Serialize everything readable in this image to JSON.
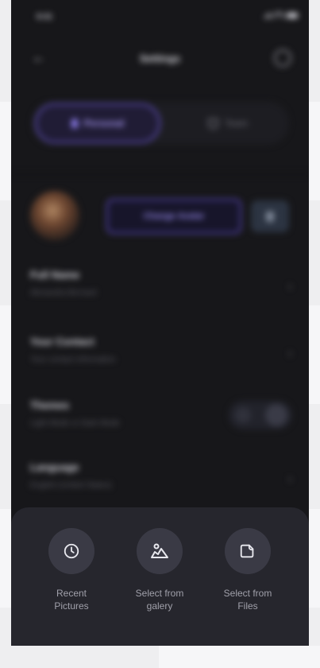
{
  "status_bar": {
    "time": "9:41"
  },
  "header": {
    "title": "Settings"
  },
  "tabs": [
    {
      "label": "Personal",
      "active": true
    },
    {
      "label": "Team",
      "active": false
    }
  ],
  "profile": {
    "change_avatar_label": "Change Avatar"
  },
  "settings_rows": [
    {
      "title": "Full Name",
      "subtitle": "Alexandra Bernard"
    },
    {
      "title": "Your Contact",
      "subtitle": "Your contact information"
    },
    {
      "title": "Themes",
      "subtitle": "Light Mode or Dark Mode"
    },
    {
      "title": "Language",
      "subtitle": "English (United States)"
    }
  ],
  "bottom_sheet": {
    "options": [
      {
        "label": "Recent\nPictures",
        "icon": "clock-icon"
      },
      {
        "label": "Select from\ngalery",
        "icon": "image-icon"
      },
      {
        "label": "Select from\nFiles",
        "icon": "file-icon"
      }
    ]
  },
  "colors": {
    "background": "#17171a",
    "accent": "#6b58d4",
    "sheet": "#26262d"
  }
}
